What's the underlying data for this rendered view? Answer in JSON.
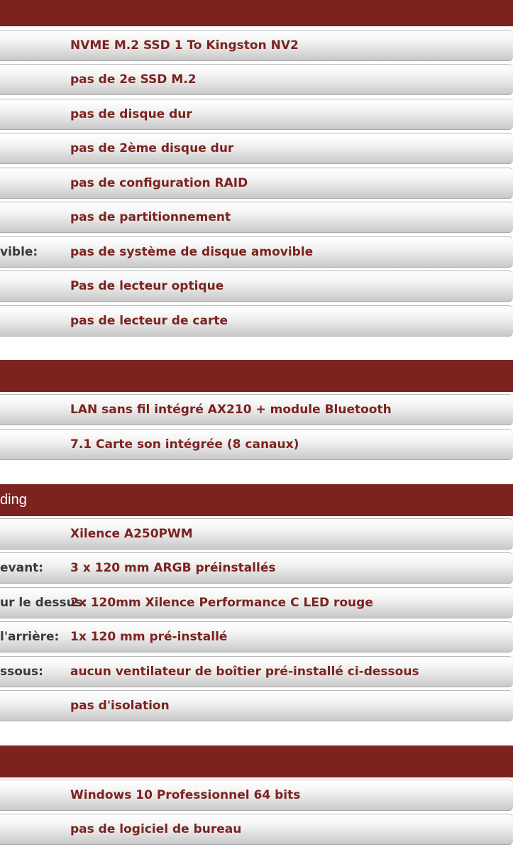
{
  "sections": [
    {
      "header": "",
      "rows": [
        {
          "label": "",
          "value": "NVME M.2 SSD 1 To Kingston NV2"
        },
        {
          "label": "",
          "value": "pas de 2e SSD M.2"
        },
        {
          "label": "",
          "value": "pas de disque dur"
        },
        {
          "label": "",
          "value": "pas de 2ème disque dur"
        },
        {
          "label": "",
          "value": "pas de configuration RAID"
        },
        {
          "label": "",
          "value": "pas de partitionnement"
        },
        {
          "label": "vible:",
          "value": "pas de système de disque amovible"
        },
        {
          "label": "",
          "value": "Pas de lecteur optique"
        },
        {
          "label": "",
          "value": "pas de lecteur de carte"
        }
      ]
    },
    {
      "header": "",
      "rows": [
        {
          "label": "",
          "value": "LAN sans fil intégré AX210 + module Bluetooth"
        },
        {
          "label": "",
          "value": "7.1 Carte son intégrée (8 canaux)"
        }
      ]
    },
    {
      "header": "ding",
      "rows": [
        {
          "label": "",
          "value": "Xilence A250PWM"
        },
        {
          "label": "evant:",
          "value": "3 x 120 mm ARGB préinstallés"
        },
        {
          "label": "ur le dessus:",
          "value": "2x 120mm Xilence Performance C LED rouge"
        },
        {
          "label": "l'arrière:",
          "value": "1x 120 mm pré-installé"
        },
        {
          "label": "ssous:",
          "value": "aucun ventilateur de boîtier pré-installé ci-dessous"
        },
        {
          "label": "",
          "value": "pas d'isolation"
        }
      ]
    },
    {
      "header": "",
      "rows": [
        {
          "label": "",
          "value": "Windows 10 Professionnel 64 bits"
        },
        {
          "label": "",
          "value": "pas de logiciel de bureau"
        }
      ]
    }
  ]
}
